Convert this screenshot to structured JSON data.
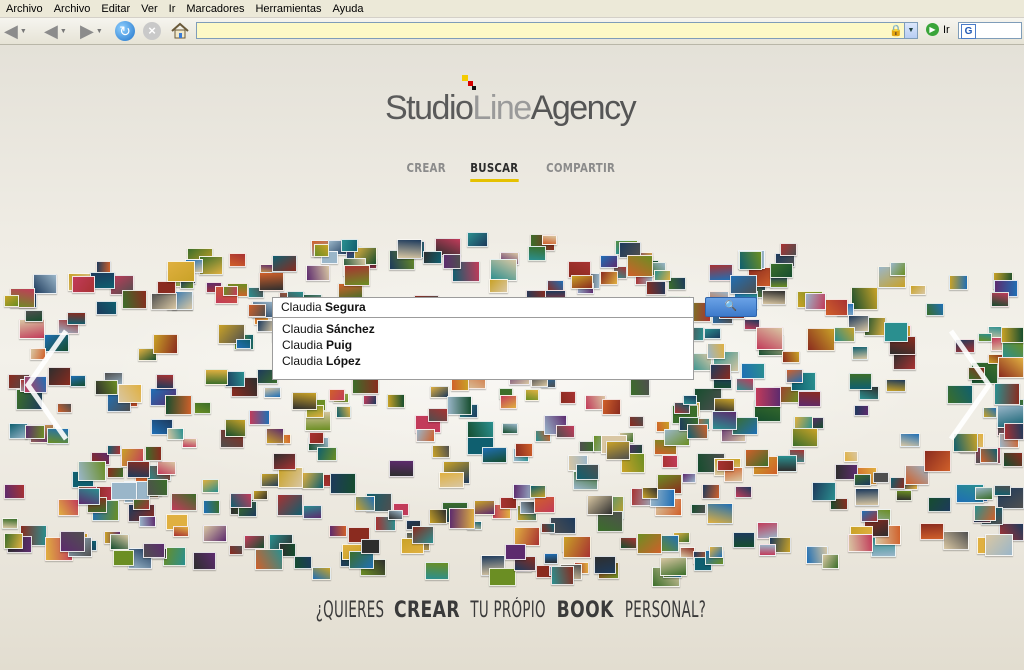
{
  "menu": [
    "Archivo",
    "Archivo",
    "Editar",
    "Ver",
    "Ir",
    "Marcadores",
    "Herramientas",
    "Ayuda"
  ],
  "toolbar": {
    "go_label": "Ir",
    "address_value": ""
  },
  "logo": {
    "part1": "Studio",
    "part2": "Line",
    "part3": "Agency"
  },
  "nav": [
    {
      "label": "CREAR",
      "active": false
    },
    {
      "label": "BUSCAR",
      "active": true
    },
    {
      "label": "COMPARTIR",
      "active": false
    }
  ],
  "search": {
    "query_prefix": "Claudia ",
    "query_bold": "Segura",
    "suggestions": [
      {
        "prefix": "Claudia ",
        "bold": "Sánchez"
      },
      {
        "prefix": "Claudia ",
        "bold": "Puig"
      },
      {
        "prefix": "Claudia ",
        "bold": "López"
      }
    ]
  },
  "tagline": {
    "p1": "¿QUIERES ",
    "b1": "CREAR",
    "p2": " TU PRÓPIO ",
    "b2": "BOOK",
    "p3": " PERSONAL?"
  },
  "colors": {
    "accent": "#e5c100",
    "search_button": "#3d7acb",
    "address_bg": "#fdf9c6"
  }
}
